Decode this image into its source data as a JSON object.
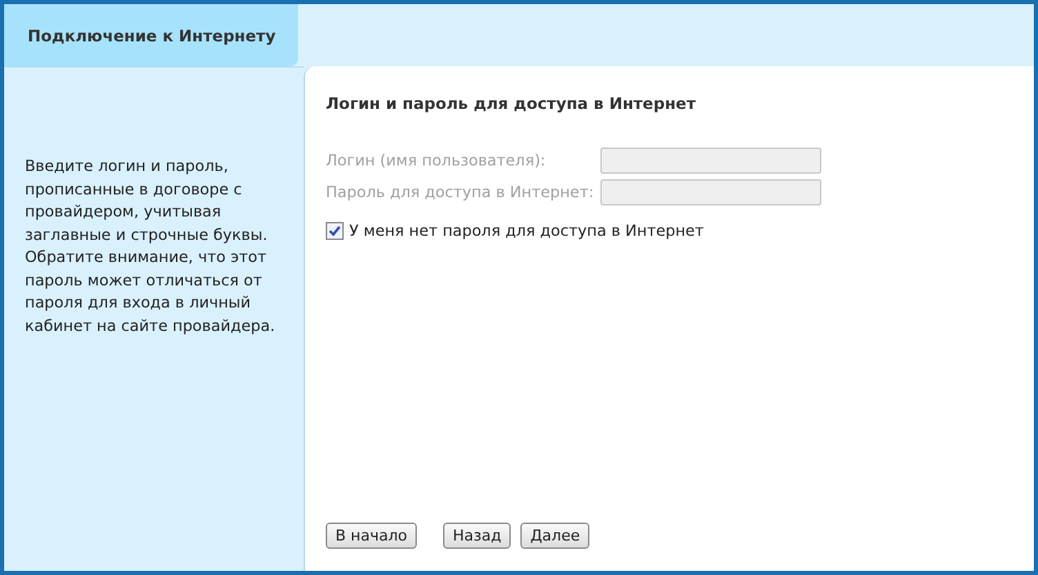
{
  "tab": {
    "label": "Подключение к Интернету",
    "selected": true
  },
  "sidebar": {
    "text": "Введите логин и пароль, прописанные в договоре с провайдером, учитывая заглавные и строчные буквы. Обратите внимание, что этот пароль может отличаться от пароля для входа в личный кабинет на сайте провайдера."
  },
  "section_title": "Логин и пароль для доступа в Интернет",
  "fields": [
    {
      "label": "Логин (имя пользователя):",
      "disabled": true
    },
    {
      "label": "Пароль для доступа в Интернет:",
      "disabled": true
    }
  ],
  "checkbox": {
    "label": "У меня нет пароля для доступа в Интернет",
    "checked": true
  },
  "buttons": [
    {
      "label": "В начало",
      "kind": "home"
    },
    {
      "label": "Назад",
      "kind": "back"
    },
    {
      "label": "Далее",
      "kind": "next"
    }
  ]
}
